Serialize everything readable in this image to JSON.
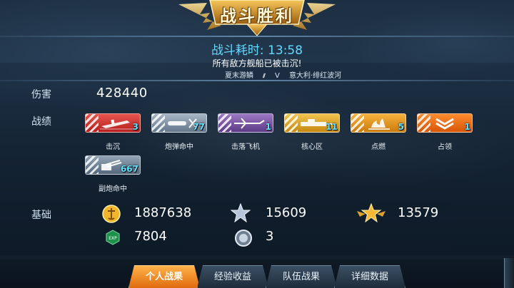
{
  "banner": {
    "title": "战斗胜利"
  },
  "battle": {
    "duration": "战斗耗时: 13:58",
    "result_message": "所有敌方舰船已被击沉!",
    "ally_name": "夏末游鳞",
    "vs": "V",
    "enemy_name": "意大利·绯红波河"
  },
  "damage": {
    "label": "伤害",
    "value": "428440"
  },
  "achievements": {
    "label": "战绩",
    "items": [
      {
        "name": "击沉",
        "count": "3",
        "icon": "sinking-ship-icon",
        "color": "#c8282a"
      },
      {
        "name": "炮弹命中",
        "count": "77",
        "icon": "shell-hit-icon",
        "color": "#6f8297"
      },
      {
        "name": "击落飞机",
        "count": "1",
        "icon": "plane-down-icon",
        "color": "#6b4592"
      },
      {
        "name": "核心区",
        "count": "11",
        "icon": "citadel-icon",
        "color": "#d49a1c"
      },
      {
        "name": "点燃",
        "count": "5",
        "icon": "fire-icon",
        "color": "#d98a14"
      },
      {
        "name": "占领",
        "count": "1",
        "icon": "capture-chevron-icon",
        "color": "#e0620e"
      },
      {
        "name": "副炮命中",
        "count": "667",
        "icon": "secondary-gun-icon",
        "color": "#607286"
      }
    ]
  },
  "basics": {
    "label": "基础",
    "credits": {
      "icon": "credits-coin-icon",
      "value": "1887638"
    },
    "silver_star": {
      "icon": "silver-star-icon",
      "value": "15609"
    },
    "gold_star": {
      "icon": "gold-winged-star-icon",
      "value": "13579"
    },
    "exp": {
      "icon": "exp-badge-icon",
      "value": "7804"
    },
    "orb": {
      "icon": "orb-icon",
      "value": "3"
    }
  },
  "tabs": [
    {
      "label": "个人战果",
      "active": true
    },
    {
      "label": "经验收益",
      "active": false
    },
    {
      "label": "队伍战果",
      "active": false
    },
    {
      "label": "详细数据",
      "active": false
    }
  ]
}
